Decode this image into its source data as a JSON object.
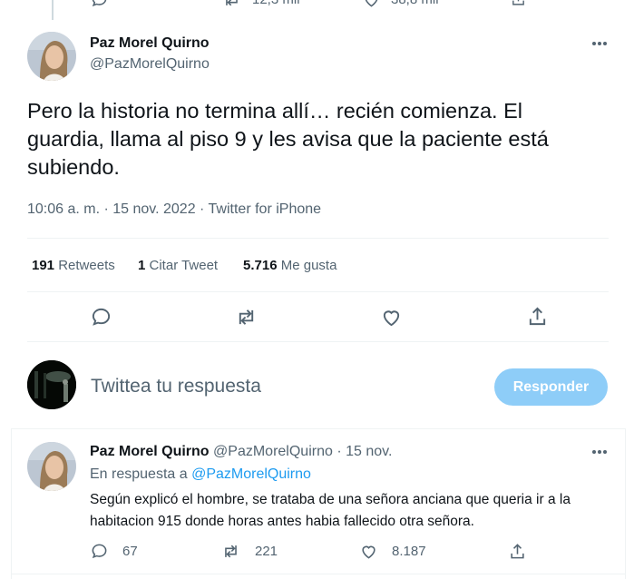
{
  "top_actions": {
    "replies": "",
    "retweets": "12,3 mil",
    "likes": "38,8 mil"
  },
  "main_tweet": {
    "author_name": "Paz Morel Quirno",
    "author_handle": "@PazMorelQuirno",
    "text": "Pero la historia no termina allí… recién comienza. El guardia, llama al piso 9 y les avisa que la paciente está subiendo.",
    "timestamp": "10:06 a. m. · 15 nov. 2022 · Twitter for iPhone",
    "stats": {
      "retweets_count": "191",
      "retweets_label": "Retweets",
      "quotes_count": "1",
      "quotes_label": "Citar Tweet",
      "likes_count": "5.716",
      "likes_label": "Me gusta"
    }
  },
  "reply_box": {
    "placeholder": "Twittea tu respuesta",
    "button_label": "Responder"
  },
  "reply_tweet": {
    "author_name": "Paz Morel Quirno",
    "author_handle": "@PazMorelQuirno",
    "date": "· 15 nov.",
    "in_reply_to_label": "En respuesta a",
    "in_reply_to_handle": "@PazMorelQuirno",
    "text": "Según explicó el hombre, se trataba de una señora anciana que queria ir a la habitacion 915 donde horas antes habia fallecido otra señora.",
    "replies": "67",
    "retweets": "221",
    "likes": "8.187"
  },
  "colors": {
    "accent": "#1d9bf0",
    "reply_button_bg": "#8ecdf8",
    "muted_text": "#536471",
    "separator": "#eff3f4"
  }
}
